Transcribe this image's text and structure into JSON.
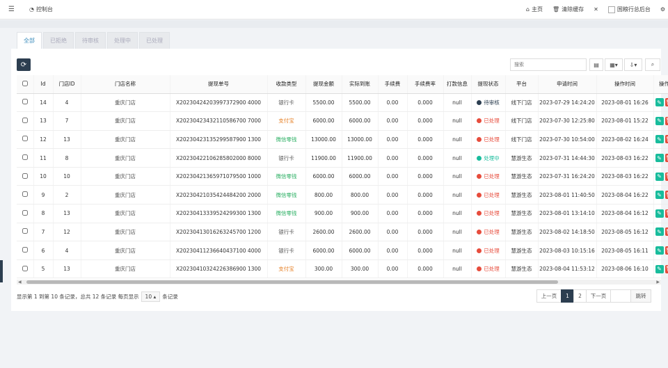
{
  "topbar": {
    "console_label": "控制台",
    "home_label": "主页",
    "clear_cache_label": "清除缓存",
    "site_name": "国粮行总后台"
  },
  "tabs": [
    {
      "label": "全部",
      "active": true
    },
    {
      "label": "已拒绝",
      "active": false
    },
    {
      "label": "待审核",
      "active": false
    },
    {
      "label": "处理中",
      "active": false
    },
    {
      "label": "已处理",
      "active": false
    }
  ],
  "search": {
    "placeholder": "搜索"
  },
  "table": {
    "headers": [
      "Id",
      "门店ID",
      "门店名称",
      "提现单号",
      "收款类型",
      "提现金额",
      "实际到账",
      "手续费",
      "手续费率",
      "打款信息",
      "提现状态",
      "平台",
      "申请时间",
      "操作时间",
      "操作"
    ],
    "rows": [
      {
        "id": "14",
        "store_id": "4",
        "store_name": "重庆门店",
        "order_no": "X20230424203997372900 4000",
        "pay_type": "银行卡",
        "pay_class": "pay-bank",
        "amount": "5500.00",
        "actual": "5500.00",
        "fee": "0.00",
        "fee_rate": "0.000",
        "pay_info": "null",
        "status": "待审核",
        "status_class": "st-pending",
        "platform": "线下门店",
        "apply_time": "2023-07-29 14:24:20",
        "op_time": "2023-08-01 16:26"
      },
      {
        "id": "13",
        "store_id": "7",
        "store_name": "重庆门店",
        "order_no": "X20230423432110586700 7000",
        "pay_type": "支付宝",
        "pay_class": "pay-alipay",
        "amount": "6000.00",
        "actual": "6000.00",
        "fee": "0.00",
        "fee_rate": "0.000",
        "pay_info": "null",
        "status": "已处理",
        "status_class": "st-done",
        "platform": "线下门店",
        "apply_time": "2023-07-30 12:25:80",
        "op_time": "2023-08-01 15:22"
      },
      {
        "id": "12",
        "store_id": "13",
        "store_name": "重庆门店",
        "order_no": "X20230423135299587900 1300",
        "pay_type": "微信零钱",
        "pay_class": "pay-wechat",
        "amount": "13000.00",
        "actual": "13000.00",
        "fee": "0.00",
        "fee_rate": "0.000",
        "pay_info": "null",
        "status": "已处理",
        "status_class": "st-done",
        "platform": "线下门店",
        "apply_time": "2023-07-30 10:54:00",
        "op_time": "2023-08-02 16:24"
      },
      {
        "id": "11",
        "store_id": "8",
        "store_name": "重庆门店",
        "order_no": "X20230422106285802000 8000",
        "pay_type": "银行卡",
        "pay_class": "pay-bank",
        "amount": "11900.00",
        "actual": "11900.00",
        "fee": "0.00",
        "fee_rate": "0.000",
        "pay_info": "null",
        "status": "处理中",
        "status_class": "st-processing",
        "platform": "慧游生态",
        "apply_time": "2023-07-31 14:44:30",
        "op_time": "2023-08-03 16:22"
      },
      {
        "id": "10",
        "store_id": "10",
        "store_name": "重庆门店",
        "order_no": "X20230421365971079500 1000",
        "pay_type": "微信零钱",
        "pay_class": "pay-wechat",
        "amount": "6000.00",
        "actual": "6000.00",
        "fee": "0.00",
        "fee_rate": "0.000",
        "pay_info": "null",
        "status": "已处理",
        "status_class": "st-done",
        "platform": "慧游生态",
        "apply_time": "2023-07-31 16:24:20",
        "op_time": "2023-08-03 16:22"
      },
      {
        "id": "9",
        "store_id": "2",
        "store_name": "重庆门店",
        "order_no": "X20230421035424484200 2000",
        "pay_type": "微信零钱",
        "pay_class": "pay-wechat",
        "amount": "800.00",
        "actual": "800.00",
        "fee": "0.00",
        "fee_rate": "0.000",
        "pay_info": "null",
        "status": "已处理",
        "status_class": "st-done",
        "platform": "慧游生态",
        "apply_time": "2023-08-01 11:40:50",
        "op_time": "2023-08-04 16:22"
      },
      {
        "id": "8",
        "store_id": "13",
        "store_name": "重庆门店",
        "order_no": "X20230413339524299300 1300",
        "pay_type": "微信零钱",
        "pay_class": "pay-wechat",
        "amount": "900.00",
        "actual": "900.00",
        "fee": "0.00",
        "fee_rate": "0.000",
        "pay_info": "null",
        "status": "已处理",
        "status_class": "st-done",
        "platform": "慧游生态",
        "apply_time": "2023-08-01 13:14:10",
        "op_time": "2023-08-04 16:12"
      },
      {
        "id": "7",
        "store_id": "12",
        "store_name": "重庆门店",
        "order_no": "X20230413016263245700 1200",
        "pay_type": "银行卡",
        "pay_class": "pay-bank",
        "amount": "2600.00",
        "actual": "2600.00",
        "fee": "0.00",
        "fee_rate": "0.000",
        "pay_info": "null",
        "status": "已处理",
        "status_class": "st-done",
        "platform": "慧游生态",
        "apply_time": "2023-08-02 14:18:50",
        "op_time": "2023-08-05 16:12"
      },
      {
        "id": "6",
        "store_id": "4",
        "store_name": "重庆门店",
        "order_no": "X20230411236640437100 4000",
        "pay_type": "银行卡",
        "pay_class": "pay-bank",
        "amount": "6000.00",
        "actual": "6000.00",
        "fee": "0.00",
        "fee_rate": "0.000",
        "pay_info": "null",
        "status": "已处理",
        "status_class": "st-done",
        "platform": "慧游生态",
        "apply_time": "2023-08-03 10:15:16",
        "op_time": "2023-08-05 16:11"
      },
      {
        "id": "5",
        "store_id": "13",
        "store_name": "重庆门店",
        "order_no": "X20230410324226386900 1300",
        "pay_type": "支付宝",
        "pay_class": "pay-alipay",
        "amount": "300.00",
        "actual": "300.00",
        "fee": "0.00",
        "fee_rate": "0.000",
        "pay_info": "null",
        "status": "已处理",
        "status_class": "st-done",
        "platform": "慧游生态",
        "apply_time": "2023-08-04 11:53:12",
        "op_time": "2023-08-06 16:10"
      }
    ]
  },
  "footer": {
    "summary_prefix": "显示第 1 到第 10 条记录，总共 12 条记录 每页显示",
    "page_size": "10",
    "summary_suffix": "条记录"
  },
  "pagination": {
    "prev": "上一页",
    "pages": [
      "1",
      "2"
    ],
    "current": "1",
    "next": "下一页",
    "jump": "跳转"
  }
}
